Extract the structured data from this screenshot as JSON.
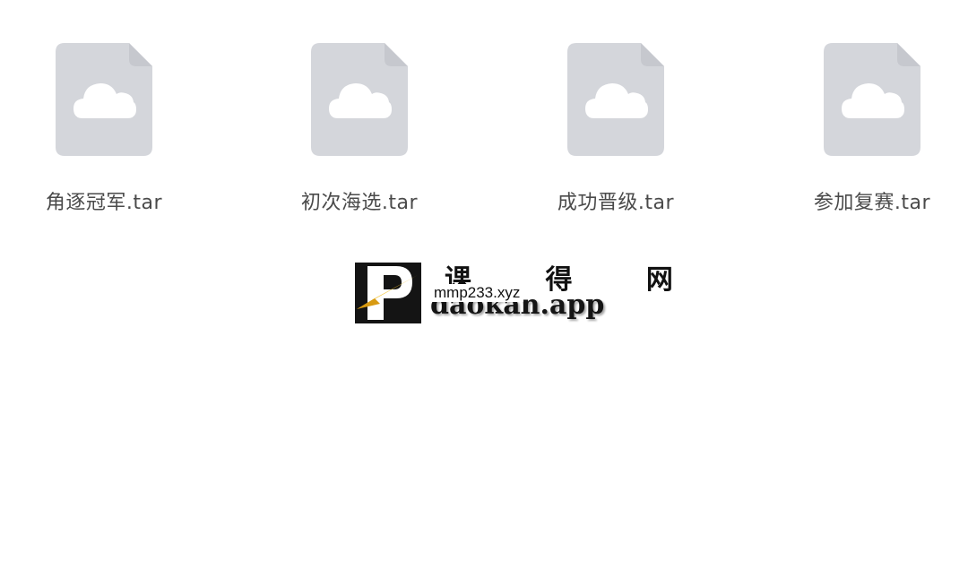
{
  "files": [
    {
      "name": "角逐冠军.tar",
      "icon": "cloud-file-icon"
    },
    {
      "name": "初次海选.tar",
      "icon": "cloud-file-icon"
    },
    {
      "name": "成功晋级.tar",
      "icon": "cloud-file-icon"
    },
    {
      "name": "参加复赛.tar",
      "icon": "cloud-file-icon"
    }
  ],
  "colors": {
    "icon_fill": "#d4d6db",
    "cloud": "#ffffff",
    "label": "#4a4a4a"
  },
  "watermark": {
    "chinese": "课 得 网",
    "brand": "daokan.app",
    "overlay": "mmp233.xyz"
  }
}
